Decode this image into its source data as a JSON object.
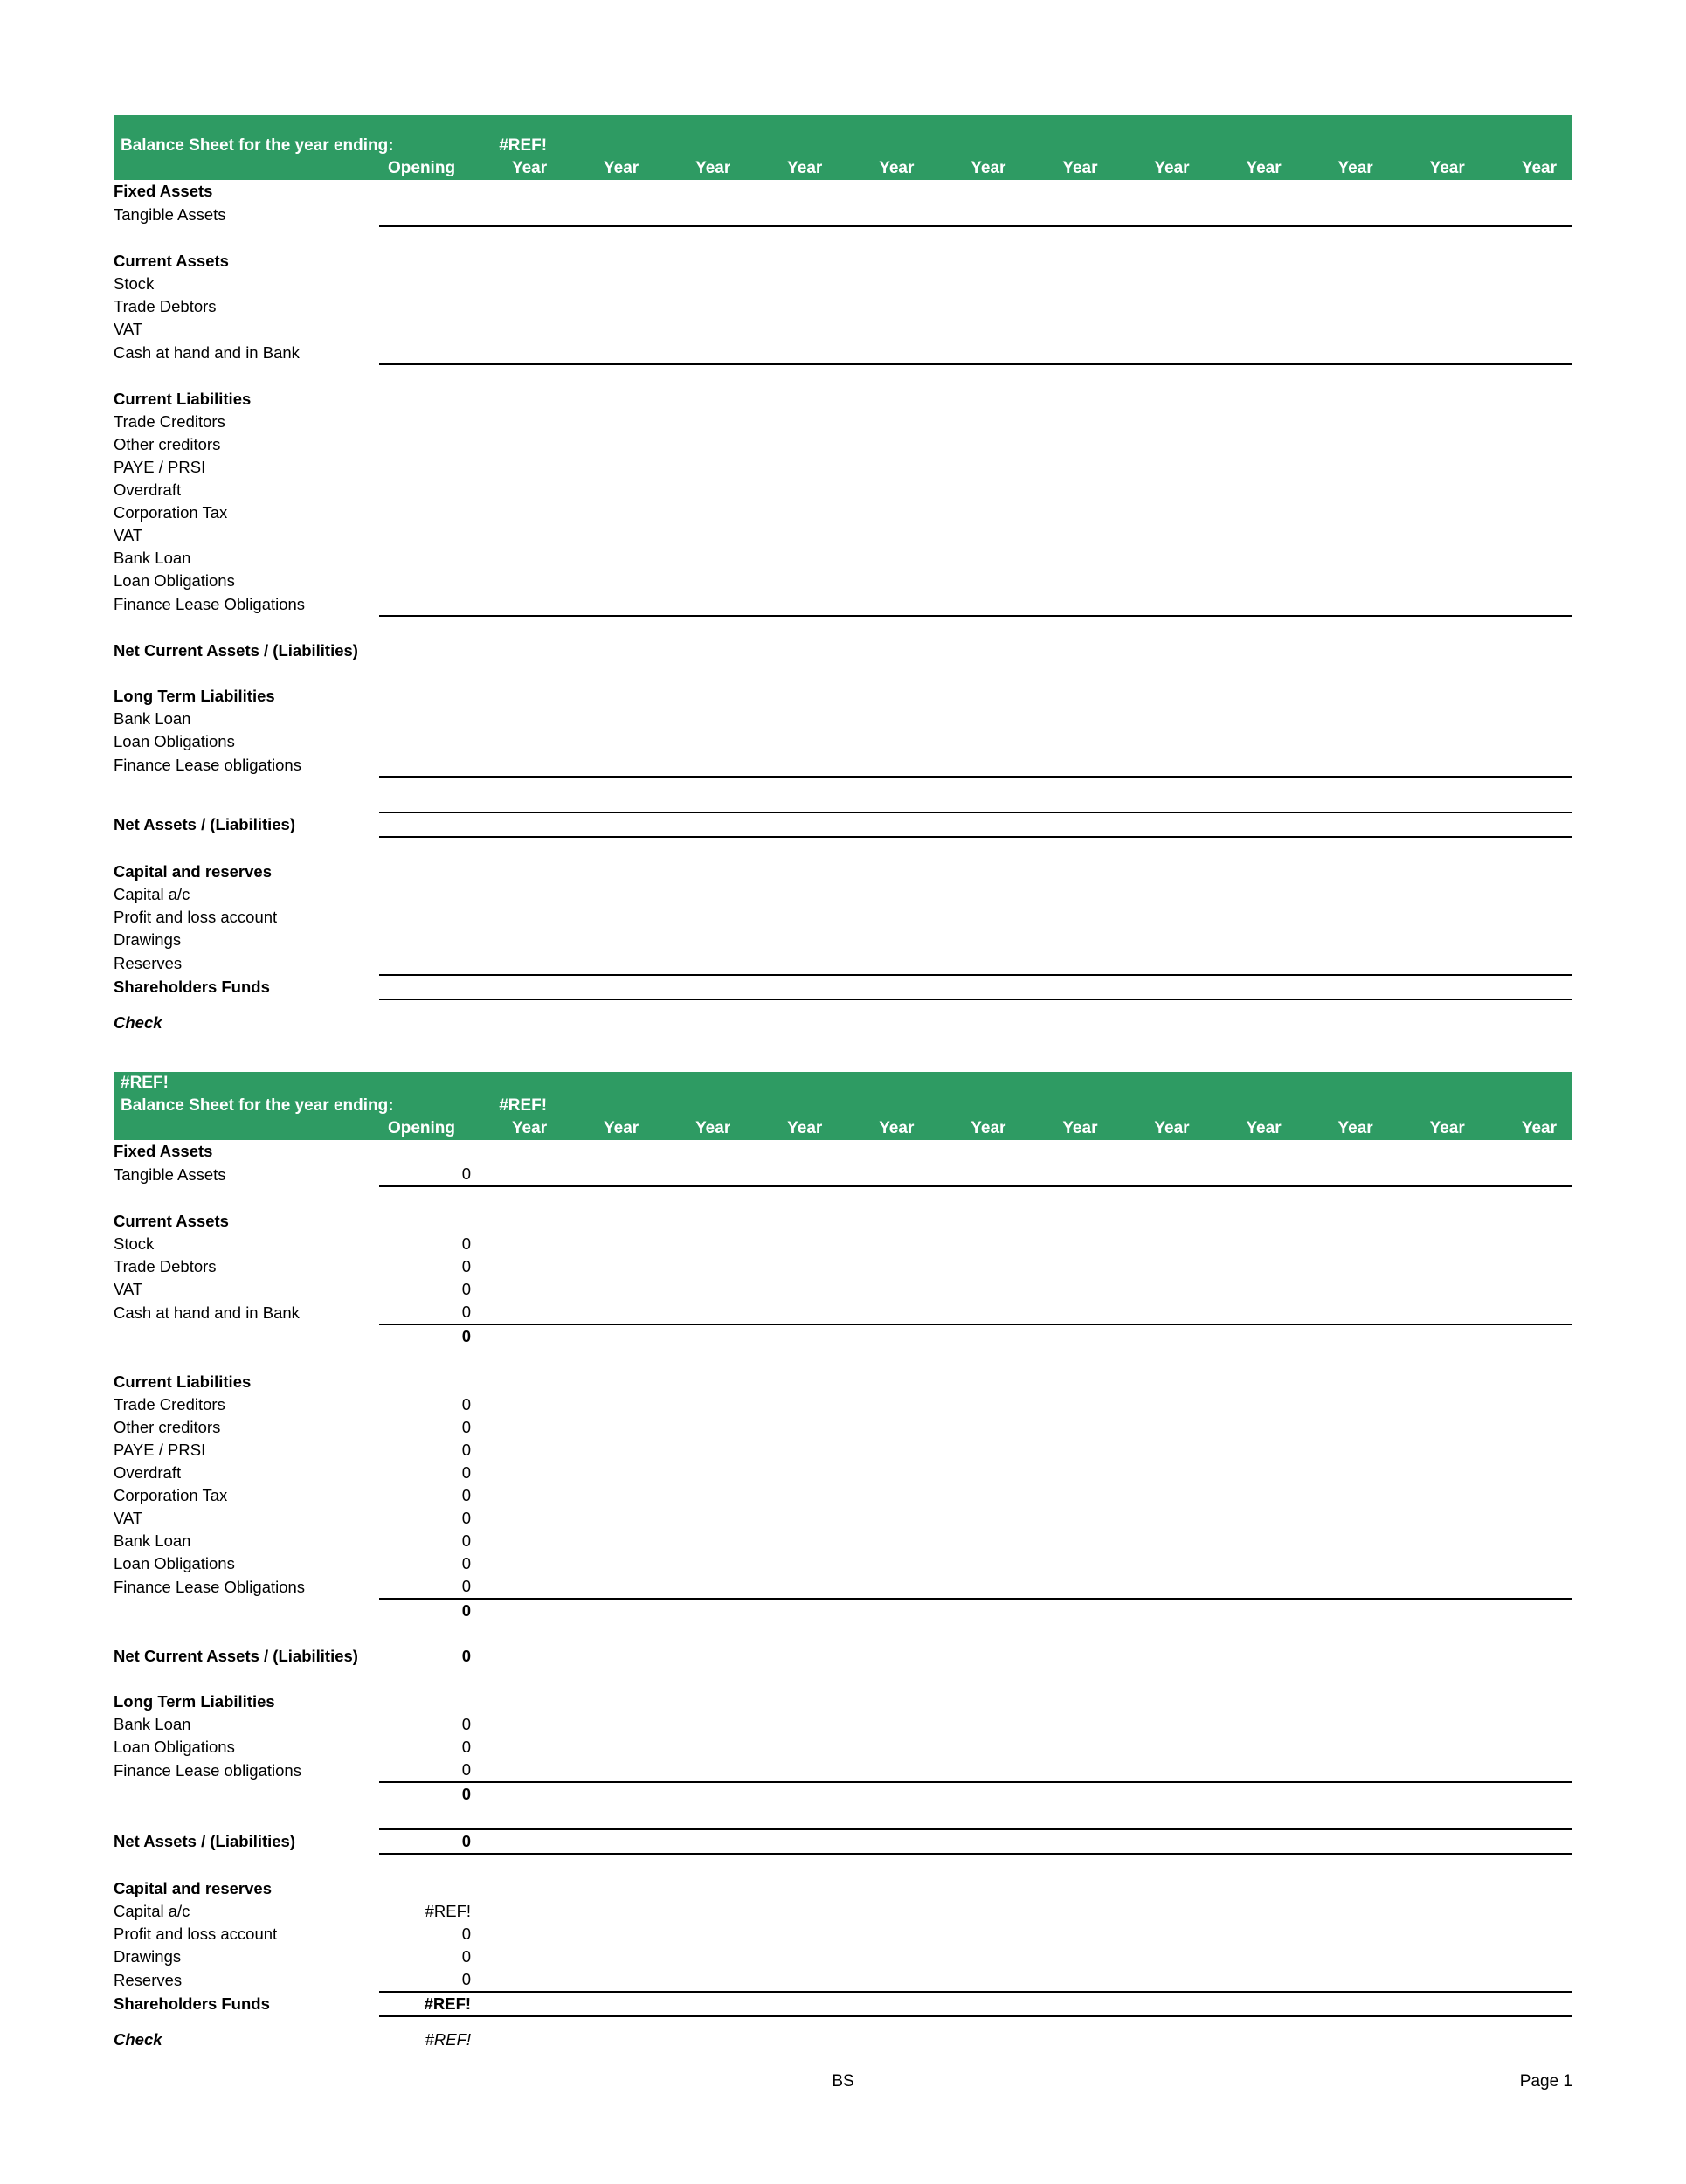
{
  "document": {
    "type": "spreadsheet-print-preview",
    "accent_color": "#2E9B63",
    "banner_text_color": "#FFFFFF"
  },
  "columns": {
    "opening_label": "Opening",
    "year_label": "Year",
    "year_count": 12
  },
  "sheet1": {
    "title": "Balance Sheet for the year ending:",
    "date_value": "#REF!",
    "sections": [
      {
        "heading": "Fixed Assets",
        "rows": [
          {
            "label": "Tangible Assets",
            "value": "",
            "rule": "bottom"
          }
        ]
      },
      {
        "heading": "Current Assets",
        "rows": [
          {
            "label": "Stock",
            "value": ""
          },
          {
            "label": "Trade Debtors",
            "value": ""
          },
          {
            "label": "VAT",
            "value": ""
          },
          {
            "label": "Cash at hand and in Bank",
            "value": "",
            "rule": "bottom"
          }
        ]
      },
      {
        "heading": "Current Liabilities",
        "rows": [
          {
            "label": "Trade Creditors",
            "value": ""
          },
          {
            "label": "Other creditors",
            "value": ""
          },
          {
            "label": "PAYE / PRSI",
            "value": ""
          },
          {
            "label": "Overdraft",
            "value": ""
          },
          {
            "label": "Corporation Tax",
            "value": ""
          },
          {
            "label": "VAT",
            "value": ""
          },
          {
            "label": "Bank Loan",
            "value": ""
          },
          {
            "label": "Loan Obligations",
            "value": ""
          },
          {
            "label": "Finance Lease Obligations",
            "value": "",
            "rule": "bottom"
          }
        ]
      }
    ],
    "net_current_assets": {
      "label": "Net Current Assets / (Liabilities)",
      "value": ""
    },
    "long_term": {
      "heading": "Long Term Liabilities",
      "rows": [
        {
          "label": "Bank Loan",
          "value": ""
        },
        {
          "label": "Loan Obligations",
          "value": ""
        },
        {
          "label": "Finance Lease obligations",
          "value": "",
          "rule": "bottom"
        }
      ]
    },
    "net_assets": {
      "label": "Net Assets / (Liabilities)",
      "value": ""
    },
    "capital": {
      "heading": "Capital and reserves",
      "rows": [
        {
          "label": "Capital a/c",
          "value": ""
        },
        {
          "label": "Profit and loss account",
          "value": ""
        },
        {
          "label": "Drawings",
          "value": ""
        },
        {
          "label": "Reserves",
          "value": "",
          "rule": "bottom"
        }
      ],
      "total": {
        "label": "Shareholders Funds",
        "value": ""
      }
    },
    "check": {
      "label": "Check",
      "value": ""
    }
  },
  "sheet2": {
    "ref_header": "#REF!",
    "title": "Balance Sheet for the year ending:",
    "date_value": "#REF!",
    "sections": [
      {
        "heading": "Fixed Assets",
        "rows": [
          {
            "label": "Tangible Assets",
            "value": "0",
            "rule": "bottom"
          }
        ]
      },
      {
        "heading": "Current Assets",
        "rows": [
          {
            "label": "Stock",
            "value": "0"
          },
          {
            "label": "Trade Debtors",
            "value": "0"
          },
          {
            "label": "VAT",
            "value": "0"
          },
          {
            "label": "Cash at hand and in Bank",
            "value": "0",
            "rule": "bottom"
          }
        ],
        "subtotal": "0"
      },
      {
        "heading": "Current Liabilities",
        "rows": [
          {
            "label": "Trade Creditors",
            "value": "0"
          },
          {
            "label": "Other creditors",
            "value": "0"
          },
          {
            "label": "PAYE / PRSI",
            "value": "0"
          },
          {
            "label": "Overdraft",
            "value": "0"
          },
          {
            "label": "Corporation Tax",
            "value": "0"
          },
          {
            "label": "VAT",
            "value": "0"
          },
          {
            "label": "Bank Loan",
            "value": "0"
          },
          {
            "label": "Loan Obligations",
            "value": "0"
          },
          {
            "label": "Finance Lease Obligations",
            "value": "0",
            "rule": "bottom"
          }
        ],
        "subtotal": "0"
      }
    ],
    "net_current_assets": {
      "label": "Net Current Assets / (Liabilities)",
      "value": "0"
    },
    "long_term": {
      "heading": "Long Term Liabilities",
      "rows": [
        {
          "label": "Bank Loan",
          "value": "0"
        },
        {
          "label": "Loan Obligations",
          "value": "0"
        },
        {
          "label": "Finance Lease obligations",
          "value": "0",
          "rule": "bottom"
        }
      ],
      "subtotal": "0"
    },
    "net_assets": {
      "label": "Net Assets / (Liabilities)",
      "value": "0"
    },
    "capital": {
      "heading": "Capital and reserves",
      "rows": [
        {
          "label": "Capital a/c",
          "value": "#REF!"
        },
        {
          "label": "Profit and loss account",
          "value": "0"
        },
        {
          "label": "Drawings",
          "value": "0"
        },
        {
          "label": "Reserves",
          "value": "0",
          "rule": "bottom"
        }
      ],
      "total": {
        "label": "Shareholders Funds",
        "value": "#REF!"
      }
    },
    "check": {
      "label": "Check",
      "value": "#REF!"
    }
  },
  "footer": {
    "center": "BS",
    "right": "Page 1"
  }
}
